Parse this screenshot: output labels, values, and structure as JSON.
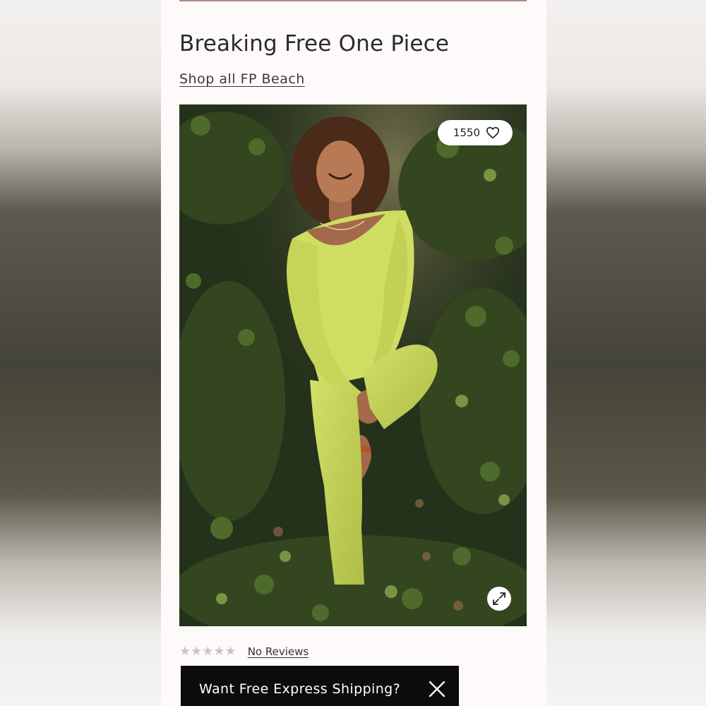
{
  "product": {
    "title": "Breaking Free One Piece",
    "shop_link": "Shop all FP Beach",
    "favorites_count": "1550",
    "rating_stars": "★★★★★",
    "reviews_label": "No Reviews"
  },
  "promo_banner": {
    "text": "Want Free Express Shipping?"
  },
  "icons": {
    "favorite": "heart-icon",
    "zoom": "expand-icon",
    "close": "close-icon"
  },
  "colors": {
    "page_background": "#fdfaf9",
    "title_text": "#2b2b2b",
    "banner_background": "#0c0c0c",
    "garment_color": "#c8d85a",
    "star_empty": "#c9c7c4"
  }
}
